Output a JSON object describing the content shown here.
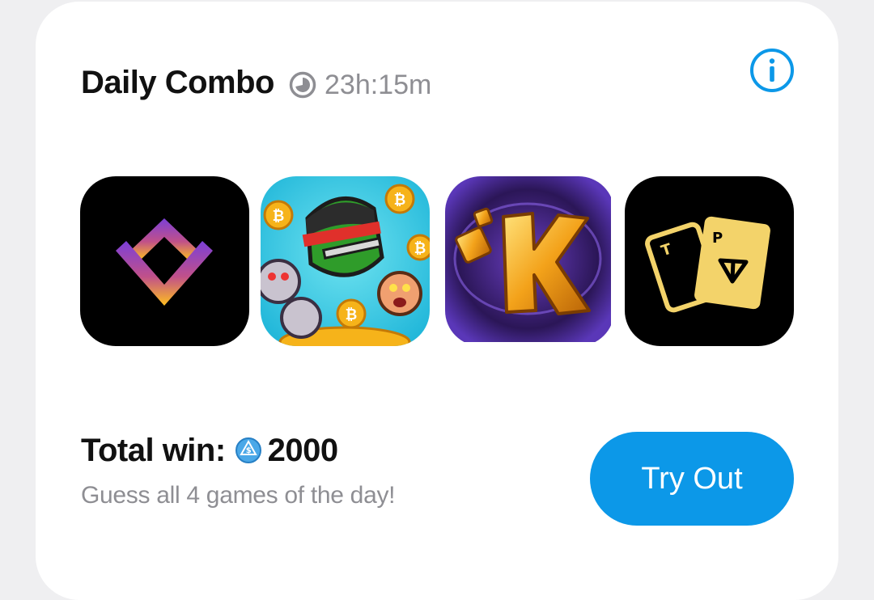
{
  "header": {
    "title": "Daily Combo",
    "timer_icon": "clock-icon",
    "timer": "23h:15m",
    "info_icon": "info-icon"
  },
  "games": [
    {
      "name": "diamond-logo-game",
      "icon": "gold-purple-diamond-logo"
    },
    {
      "name": "ninja-zombie-game",
      "icon": "ninja-bitcoin-zombies"
    },
    {
      "name": "k-game",
      "icon": "golden-k-logo"
    },
    {
      "name": "tp-cards-game",
      "icon": "tp-cards-logo"
    }
  ],
  "footer": {
    "total_label": "Total win:",
    "coin_icon": "point-coin-icon",
    "total_value": "2000",
    "subtitle": "Guess all 4 games of the day!",
    "button_label": "Try Out"
  },
  "colors": {
    "accent": "#0c98e8",
    "muted_text": "#8e8e93",
    "title_text": "#111111",
    "card_bg": "#ffffff",
    "page_bg": "#efeff1"
  }
}
